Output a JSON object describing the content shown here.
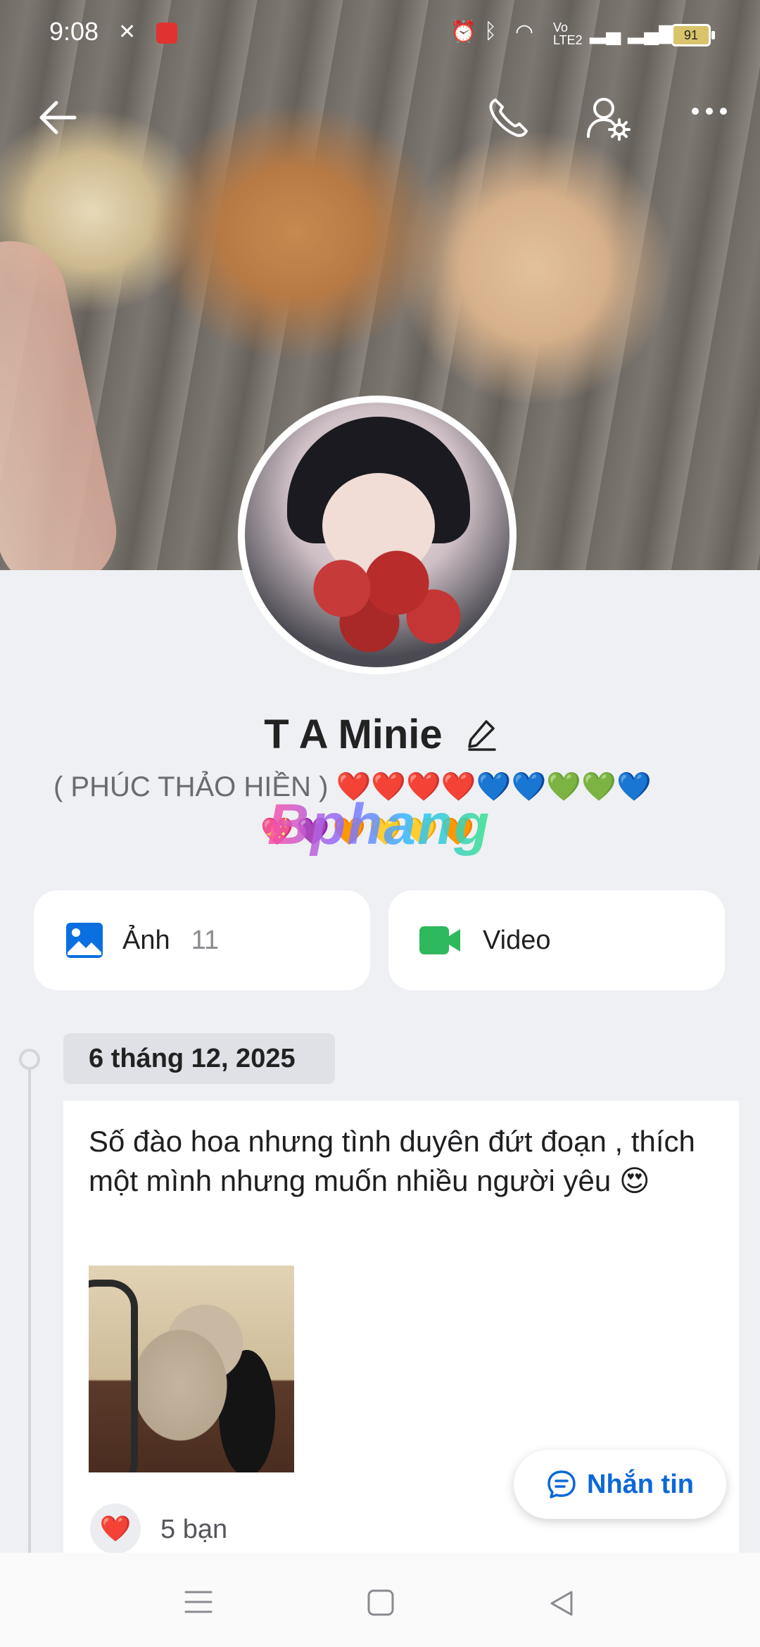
{
  "status_bar": {
    "time": "9:08",
    "battery": "91",
    "network_label": "LTE2",
    "volte_label": "Vo"
  },
  "profile": {
    "name": "T A Minie",
    "bio": "( PHÚC THẢO HIỀN ) ❤️❤️❤️❤️💙💙💚💚💙",
    "bio_emojis": "💖💜🧡💛💛🧡",
    "watermark": "Bphang"
  },
  "media": {
    "photos_label": "Ảnh",
    "photos_count": "11",
    "video_label": "Video"
  },
  "timeline": {
    "date": "6 tháng 12, 2025",
    "post_text": "Số đào hoa nhưng tình duyên đứt đoạn , thích một mình nhưng muốn nhiều người yêu 😍",
    "reaction_emoji": "❤️",
    "reaction_count": "5 bạn"
  },
  "actions": {
    "message_label": "Nhắn tin"
  },
  "icons": {
    "back": "arrow-left-icon",
    "call": "phone-icon",
    "settings": "user-settings-icon",
    "more": "more-horizontal-icon",
    "edit": "pencil-icon",
    "photo": "image-icon",
    "video": "video-camera-icon",
    "message": "chat-bubble-icon"
  },
  "colors": {
    "accent": "#0b68d8",
    "photo_icon": "#0a6fe0",
    "video_icon": "#2eb85c",
    "background": "#eef0f4"
  }
}
